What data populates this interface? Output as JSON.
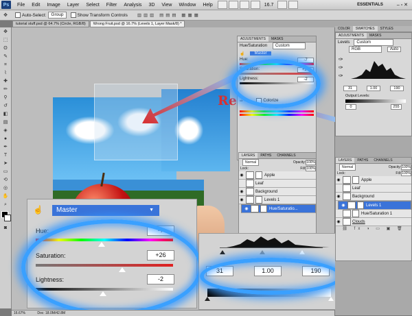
{
  "menubar": {
    "logo": "Ps",
    "items": [
      "File",
      "Edit",
      "Image",
      "Layer",
      "Select",
      "Filter",
      "Analysis",
      "3D",
      "View",
      "Window",
      "Help"
    ],
    "zoom": "16.7",
    "workspace": "ESSENTIALS"
  },
  "options": {
    "auto_select_label": "Auto-Select:",
    "auto_select_value": "Group",
    "transform_label": "Show Transform Controls"
  },
  "tabs": [
    "tutorial stuff.psd @ 64.7% (Circle, RGB/8)",
    "Wrong Fruit.psd @ 16.7% (Levels 1, Layer Mask/8) *"
  ],
  "status": {
    "zoom": "16.67%",
    "doc": "Doc: 18.0M/42.8M"
  },
  "annotation_text": "Re",
  "hs_zoom": {
    "preset": "Master",
    "hue_label": "Hue:",
    "hue_value": "-7",
    "sat_label": "Saturation:",
    "sat_value": "+26",
    "light_label": "Lightness:",
    "light_value": "-2",
    "hue": -7,
    "saturation": 26,
    "lightness": -2
  },
  "levels_zoom": {
    "black": "31",
    "gamma": "1.00",
    "white": "190"
  },
  "adj_panel_small": {
    "tabs": [
      "ADJUSTMENTS",
      "MASKS"
    ],
    "title": "Hue/Saturation",
    "preset": "Custom",
    "channel": "Master",
    "hue_label": "Hue:",
    "hue_value": "-7",
    "sat_label": "Saturation:",
    "sat_value": "+26",
    "light_label": "Lightness:",
    "light_value": "-2",
    "colorize": "Colorize"
  },
  "layers_small": {
    "tabs": [
      "LAYERS",
      "PATHS",
      "CHANNELS"
    ],
    "mode": "Normal",
    "opacity_label": "Opacity:",
    "opacity": "100%",
    "fill_label": "Fill:",
    "fill": "100%",
    "lock_label": "Lock:",
    "layers": [
      "Apple",
      "Leaf",
      "Background",
      "Levels 1",
      "Hue/Saturatio..."
    ]
  },
  "right_panel": {
    "top_tabs": [
      "COLOR",
      "SWATCHES",
      "STYLES"
    ],
    "adj_tabs": [
      "ADJUSTMENTS",
      "MASKS"
    ],
    "title": "Levels",
    "preset": "Custom",
    "channel": "RGB",
    "auto": "Auto",
    "black": "31",
    "gamma": "1.00",
    "white": "190",
    "output_label": "Output Levels:",
    "out_black": "0",
    "out_white": "255"
  },
  "right_layers": {
    "tabs": [
      "LAYERS",
      "PATHS",
      "CHANNELS"
    ],
    "mode": "Normal",
    "opacity_label": "Opacity:",
    "opacity": "100%",
    "lock_label": "Lock:",
    "fill_label": "Fill:",
    "fill": "100%",
    "layers": [
      "Apple",
      "Leaf",
      "Background",
      "Levels 1",
      "Hue/Saturation 1",
      "Clouds"
    ]
  },
  "colors": {
    "accent": "#3a73d9",
    "glow": "#3aa0ff",
    "arrow": "#d93030"
  }
}
